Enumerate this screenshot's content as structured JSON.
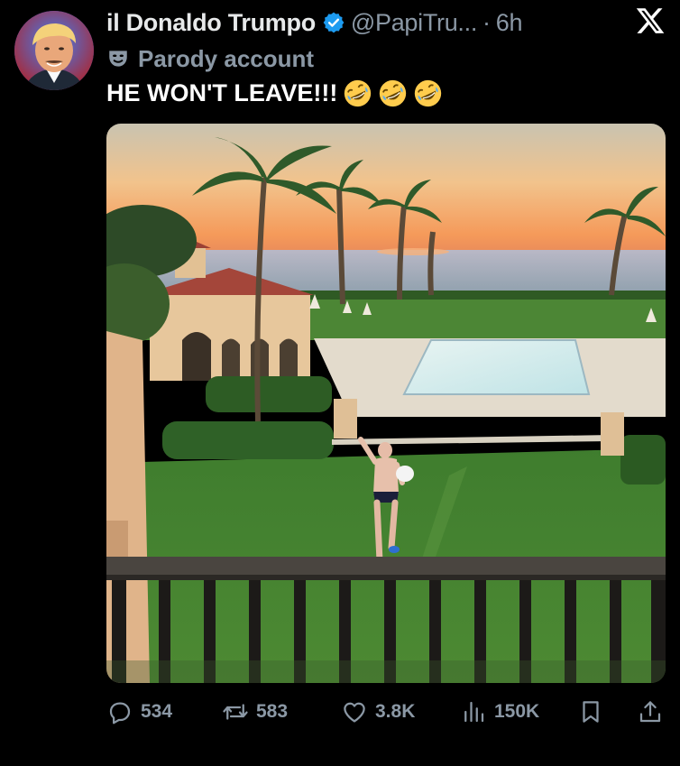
{
  "post": {
    "display_name": "il Donaldo Trumpo",
    "handle": "@PapiTru...",
    "separator": "·",
    "time": "6h",
    "parody_label": "Parody account",
    "text": "HE WON'T LEAVE!!!",
    "emojis": [
      "rolling-on-floor-laughing-emoji",
      "rolling-on-floor-laughing-emoji",
      "rolling-on-floor-laughing-emoji"
    ]
  },
  "actions": {
    "replies": "534",
    "reposts": "583",
    "likes": "3.8K",
    "views": "150K"
  },
  "icons": [
    "x-logo-icon",
    "verified-badge-icon",
    "parody-mask-icon",
    "reply-icon",
    "repost-icon",
    "like-icon",
    "views-icon",
    "bookmark-icon",
    "share-icon"
  ],
  "colors": {
    "background": "#000000",
    "text_primary": "#e7e9ea",
    "text_secondary": "#8b98a5",
    "verified_blue": "#1d9bf0"
  }
}
